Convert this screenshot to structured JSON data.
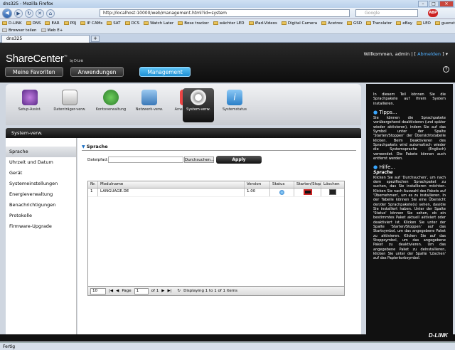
{
  "browser": {
    "title": "dns325 - Mozilla Firefox",
    "url": "http://localhost:10000/web/management.html?id=system",
    "search_placeholder": "Google",
    "tab_title": "dns325",
    "bookmarks": [
      "D-LINK",
      "DNS",
      "EAR",
      "PRJ",
      "IP CAMs",
      "SAT",
      "DCS",
      "Watch Later",
      "Bose tracker",
      "wächter LED",
      "iPad-Videos",
      "Digital Camera",
      "Acetrex",
      "GSD",
      "Translator",
      "eBay",
      "LEO",
      "guenstiger"
    ],
    "bookmarks2": [
      "Browser teilen",
      "Web E+"
    ],
    "status": "Fertig"
  },
  "header": {
    "brand": "ShareCenter",
    "brand_tm": "™",
    "brand_by": "by D-Link",
    "welcome": "Willkommen, admin |",
    "logout": "Abmelden",
    "tabs": [
      "Meine Favoriten",
      "Anwendungen",
      "Management"
    ]
  },
  "apps": [
    {
      "label": "Setup-Assist."
    },
    {
      "label": "Datenträger-verw."
    },
    {
      "label": "Kontoverwaltung"
    },
    {
      "label": "Netzwerk-verw."
    },
    {
      "label": "Anwend.-verw."
    },
    {
      "label": "System-verw."
    },
    {
      "label": "Systemstatus"
    }
  ],
  "section_title": "System-verw.",
  "sidebar": [
    "Sprache",
    "Uhrzeit und Datum",
    "Gerät",
    "Systemeinstellungen",
    "Energieverwaltung",
    "Benachrichtigungen",
    "Protokolle",
    "Firmware-Upgrade"
  ],
  "panel": {
    "title": "Sprache",
    "dateipfad_label": "Dateipfad:",
    "browse": "Durchsuchen...",
    "apply": "Apply"
  },
  "table": {
    "columns": [
      "Nr.",
      "Modulname",
      "Version",
      "Status",
      "Starten/Stopp",
      "Löschen"
    ],
    "rows": [
      {
        "nr": "1",
        "name": "LANGUAGE.DE",
        "version": "1.00"
      }
    ]
  },
  "pager": {
    "page_size": "10",
    "page_label": "Page",
    "page": "1",
    "of": "of 1",
    "display": "Displaying 1 to 1 of 1 items"
  },
  "help": {
    "intro": "In diesem Teil können Sie die Sprachpakete auf Ihrem System installieren.",
    "tips_title": "Tipps...",
    "tips": "Sie können die Sprachpakete vorübergehend deaktivieren (und später wieder aktivieren), indem Sie auf das Symbol unter der Spalte 'Starten/Stoppen' der Übersichtstabelle klicken. Beim Deaktivieren des Sprachpakets wird automatisch wieder die Systemsprache (Englisch) verwendet. Die Pakete können auch entfernt werden.",
    "hilfe_title": "Hilfe...",
    "hilfe_sub": "Sprache",
    "hilfe": "Klicken Sie auf 'Durchsuchen', um nach dem spezifischen Sprachpaket zu suchen, das Sie installieren möchten. Klicken Sie nach Auswahl des Pakets auf 'Übernehmen', um es zu installieren. In der Tabelle können Sie eine Übersicht der/der Sprachpakete(s) sehen, das/die Sie installiert haben. Unter der Spalte 'Status' können Sie sehen, ob ein bestimmtes Paket aktuell aktiviert oder deaktiviert ist. Klicken Sie unter der Spalte 'Starten/Stoppen' auf das Startsymbol, um das angegebene Paket zu aktivieren. Klicken Sie auf das Stoppsymbol, um das angegebene Paket zu deaktivieren. Um das angegebene Paket zu deinstallieren, klicken Sie unter der Spalte 'Löschen' auf das Papierkorbsymbol."
  },
  "footer_brand": "D-LINK",
  "colors": {
    "accent": "#1e8fd3",
    "dark": "#111111"
  }
}
